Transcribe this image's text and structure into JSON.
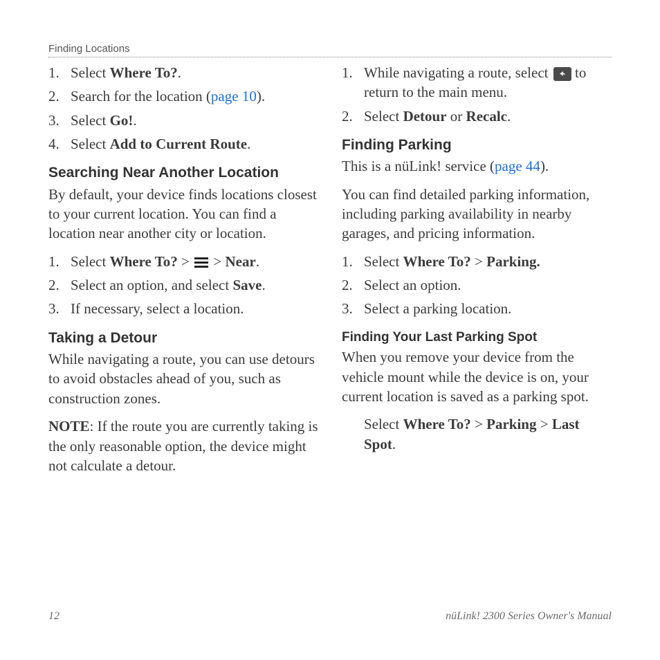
{
  "header": {
    "breadcrumb": "Finding Locations"
  },
  "footer": {
    "page": "12",
    "manual": "nüLink! 2300 Series Owner's Manual"
  },
  "left": {
    "list1": {
      "i1_a": "Select ",
      "i1_b": "Where To?",
      "i1_c": ".",
      "i2_a": "Search for the location (",
      "i2_link": "page 10",
      "i2_b": ").",
      "i3_a": "Select ",
      "i3_b": "Go!",
      "i3_c": ".",
      "i4_a": "Select ",
      "i4_b": "Add to Current Route",
      "i4_c": "."
    },
    "sec1": {
      "title": "Searching Near Another Location",
      "p": "By default, your device finds locations closest to your current location. You can find a location near another city or location.",
      "i1_a": "Select ",
      "i1_b": "Where To?",
      "i1_c": " > ",
      "i1_d": " > ",
      "i1_e": "Near",
      "i1_f": ".",
      "i2_a": "Select an option, and select ",
      "i2_b": "Save",
      "i2_c": ".",
      "i3": "If necessary, select a location."
    },
    "sec2": {
      "title": "Taking a Detour",
      "p": "While navigating a route, you can use detours to avoid obstacles ahead of you, such as construction zones.",
      "note_b": "NOTE",
      "note_t": ": If the route you are currently taking is the only reasonable option, the device might not calculate a detour."
    }
  },
  "right": {
    "list1": {
      "i1_a": "While navigating a route, select ",
      "i1_b": " to return to the main menu.",
      "i2_a": "Select ",
      "i2_b": "Detour",
      "i2_c": " or ",
      "i2_d": "Recalc",
      "i2_e": "."
    },
    "sec1": {
      "title": "Finding Parking",
      "p1_a": "This is a nüLink! service (",
      "p1_link": "page 44",
      "p1_b": ").",
      "p2": "You can find detailed parking information, including parking availability in nearby garages, and pricing information.",
      "i1_a": "Select ",
      "i1_b": "Where To?",
      "i1_c": " > ",
      "i1_d": "Parking.",
      "i2": "Select an option.",
      "i3": "Select a parking location."
    },
    "sec2": {
      "title": "Finding Your Last Parking Spot",
      "p": "When you remove your device from the vehicle mount while the device is on, your current location is saved as a parking spot.",
      "step_a": "Select ",
      "step_b": "Where To?",
      "step_c": " > ",
      "step_d": "Parking",
      "step_e": " > ",
      "step_f": "Last Spot",
      "step_g": "."
    }
  }
}
